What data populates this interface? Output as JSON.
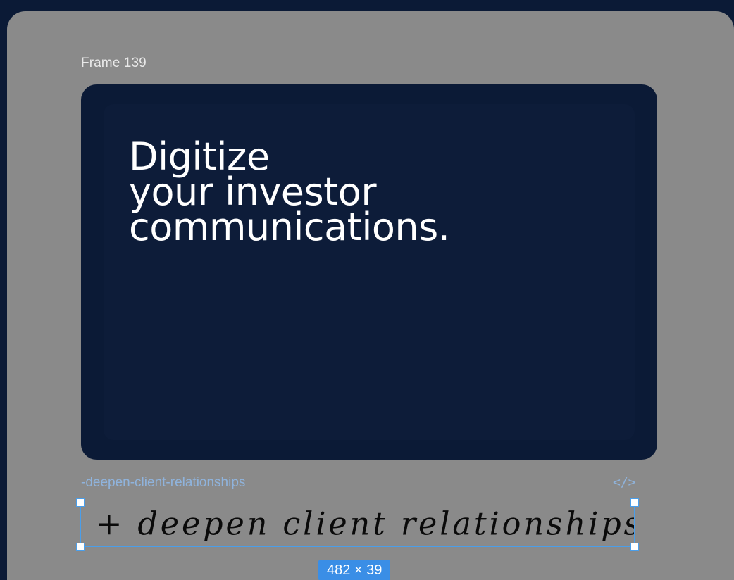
{
  "canvas": {
    "frame_label": "Frame 139",
    "frame": {
      "headline_lines": [
        "Digitize",
        "your investor",
        "communications."
      ]
    },
    "layer_name": "-deepen-client-relationships",
    "code_icon": "</>",
    "selection": {
      "handwritten_text": "+ deepen client relationships",
      "dimensions": "482 × 39"
    }
  },
  "colors": {
    "page_background": "#0b1a36",
    "canvas_background": "#8a8a8a",
    "frame_background": "#0b1a36",
    "selection_accent": "#4a9eea",
    "layer_label": "#8fb3dc"
  }
}
